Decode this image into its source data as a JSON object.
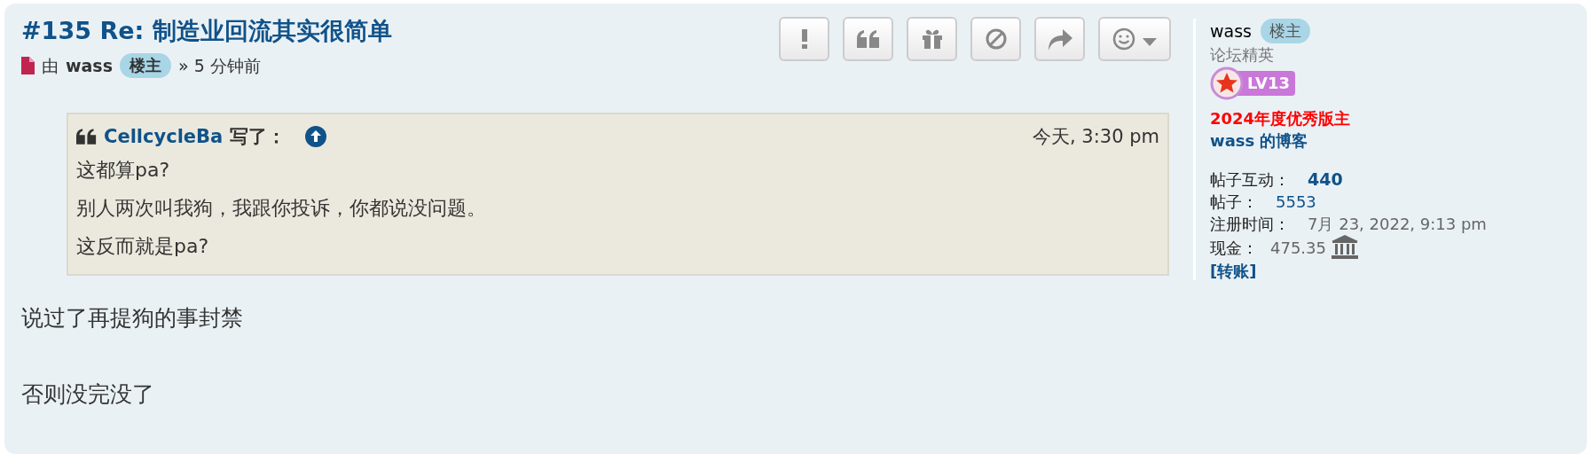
{
  "post": {
    "title": "#135 Re: 制造业回流其实很简单",
    "meta": {
      "by": "由",
      "author": "wass",
      "author_badge": "楼主",
      "separator": "»",
      "time": "5 分钟前"
    }
  },
  "actions": [
    {
      "kind": "report"
    },
    {
      "kind": "quote"
    },
    {
      "kind": "gift"
    },
    {
      "kind": "block"
    },
    {
      "kind": "share"
    },
    {
      "kind": "reaction"
    }
  ],
  "quote": {
    "author": "CellcycleBa",
    "wrote": "写了：",
    "time": "今天, 3:30 pm",
    "lines": [
      "这都算pa?",
      "别人两次叫我狗，我跟你投诉，你都说没问题。",
      "这反而就是pa?"
    ]
  },
  "body": [
    "说过了再提狗的事封禁",
    "否则没完没了"
  ],
  "profile": {
    "username": "wass",
    "badge": "楼主",
    "rank": "论坛精英",
    "level": "LV13",
    "award": "2024年度优秀版主",
    "blog_link": "wass 的博客",
    "stats": [
      {
        "label": "帖子互动：",
        "value": "440",
        "kind": "bold-link"
      },
      {
        "label": "帖子：",
        "value": "5553",
        "kind": "link"
      },
      {
        "label": "注册时间：",
        "value": "7月 23, 2022, 9:13 pm",
        "kind": "plain"
      },
      {
        "label": "现金：",
        "value": "475.35",
        "kind": "bank"
      }
    ],
    "transfer_link": "[转账]"
  }
}
